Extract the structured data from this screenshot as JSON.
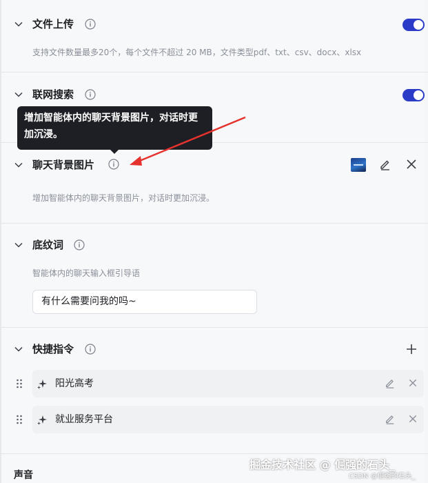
{
  "sections": {
    "file_upload": {
      "title": "文件上传",
      "description": "支持文件数量最多20个，每个文件不超过 20 MB，文件类型pdf、txt、csv、docx、xlsx",
      "enabled": true
    },
    "web_search": {
      "title": "联网搜索",
      "enabled": true
    },
    "chat_background": {
      "title": "聊天背景图片",
      "description": "增加智能体内的聊天背景图片，对话时更加沉浸。",
      "tooltip": "增加智能体内的聊天背景图片，对话时更加沉浸。"
    },
    "hint_text": {
      "title": "底纹词",
      "description": "智能体内的聊天输入框引导语",
      "input_value": "有什么需要问我的吗~"
    },
    "quick_commands": {
      "title": "快捷指令",
      "items": [
        {
          "label": "阳光高考"
        },
        {
          "label": "就业服务平台"
        }
      ]
    },
    "sound": {
      "title": "声音"
    }
  },
  "watermark": {
    "main": "掘金技术社区 @ 倔强的石头_",
    "sub": "CSDN @倔强的石头_"
  },
  "colors": {
    "toggle_on": "#2a3cc7",
    "tooltip_bg": "#1e1f24",
    "annotation_arrow": "#e5322d"
  }
}
